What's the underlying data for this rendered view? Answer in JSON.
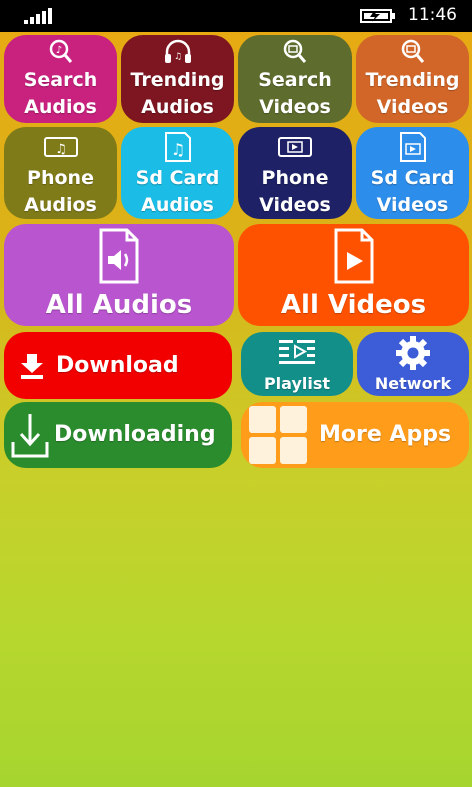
{
  "status": {
    "time": "11:46",
    "signal_icon": "signal-strength-icon",
    "battery_icon": "battery-charging-icon"
  },
  "tiles": {
    "search_audios": {
      "label": "Search\nAudios",
      "color": "#c8217e",
      "icon": "search-music-icon"
    },
    "trending_audios": {
      "label": "Trending\nAudios",
      "color": "#7d1620",
      "icon": "headphones-icon"
    },
    "search_videos": {
      "label": "Search\nVideos",
      "color": "#5e6d2d",
      "icon": "search-video-icon"
    },
    "trending_videos": {
      "label": "Trending\nVideos",
      "color": "#d26628",
      "icon": "search-video-icon"
    },
    "phone_audios": {
      "label": "Phone\nAudios",
      "color": "#7f7b18",
      "icon": "phone-music-icon"
    },
    "sd_audios": {
      "label": "Sd Card\nAudios",
      "color": "#1bbde6",
      "icon": "sdcard-music-icon"
    },
    "phone_videos": {
      "label": "Phone\nVideos",
      "color": "#1e2166",
      "icon": "phone-video-icon"
    },
    "sd_videos": {
      "label": "Sd Card\nVideos",
      "color": "#2d8dea",
      "icon": "sdcard-video-icon"
    },
    "all_audios": {
      "label": "All Audios",
      "color": "#b955cf",
      "icon": "audio-file-icon"
    },
    "all_videos": {
      "label": "All Videos",
      "color": "#ff5200",
      "icon": "video-file-icon"
    },
    "download": {
      "label": "Download",
      "color": "#f20000",
      "icon": "download-icon"
    },
    "playlist": {
      "label": "Playlist",
      "color": "#138f8a",
      "icon": "playlist-icon"
    },
    "network": {
      "label": "Network",
      "color": "#3c5cd8",
      "icon": "gear-icon"
    },
    "downloading": {
      "label": "Downloading",
      "color": "#2b8c2e",
      "icon": "downloading-icon"
    },
    "more_apps": {
      "label": "More Apps",
      "color": "#ff9c1a",
      "icon": "grid-apps-icon"
    }
  }
}
